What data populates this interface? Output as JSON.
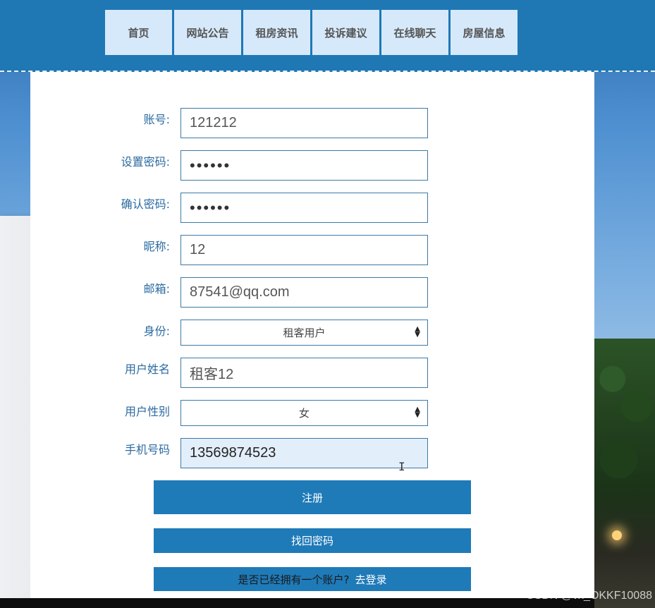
{
  "nav": [
    {
      "label": "首页"
    },
    {
      "label": "网站公告"
    },
    {
      "label": "租房资讯"
    },
    {
      "label": "投诉建议"
    },
    {
      "label": "在线聊天"
    },
    {
      "label": "房屋信息"
    }
  ],
  "form": {
    "account": {
      "label": "账号:",
      "value": "121212"
    },
    "password": {
      "label": "设置密码:",
      "value": "••••••"
    },
    "confirm_password": {
      "label": "确认密码:",
      "value": "••••••"
    },
    "nickname": {
      "label": "昵称:",
      "value": "12"
    },
    "email": {
      "label": "邮箱:",
      "value": "87541@qq.com"
    },
    "role": {
      "label": "身份:",
      "selected": "租客用户"
    },
    "real_name": {
      "label": "用户姓名",
      "value": "租客12"
    },
    "gender": {
      "label": "用户性别",
      "selected": "女"
    },
    "phone": {
      "label": "手机号码",
      "value": "13569874523"
    }
  },
  "buttons": {
    "register": "注册",
    "retrieve_password": "找回密码",
    "has_account_prompt": "是否已经拥有一个账户?",
    "go_login": "去登录"
  },
  "watermark": "CSDN @vx_OKKF10088",
  "colors": {
    "header": "#1f78b4",
    "nav_item_bg": "#d6e9fb",
    "button": "#1f7ab8",
    "label": "#2b6aa0"
  }
}
